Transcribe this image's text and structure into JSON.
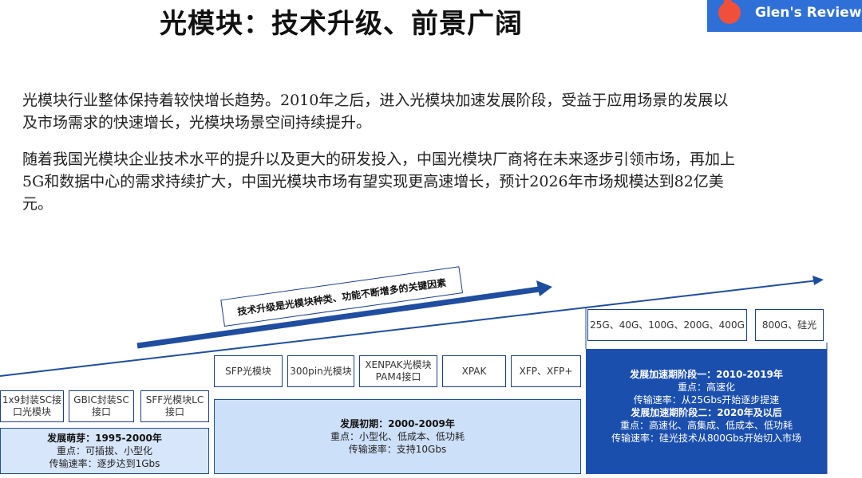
{
  "title": "光模块：技术升级、前景广阔",
  "logo": {
    "text": "Glen's Review"
  },
  "paragraphs": [
    "光模块行业整体保持着较快增长趋势。2010年之后，进入光模块加速发展阶段，受益于应用场景的发展以及市场需求的快速增长，光模块场景空间持续提升。",
    "随着我国光模块企业技术水平的提升以及更大的研发投入，中国光模块厂商将在未来逐步引领市场，再加上5G和数据中心的需求持续扩大，中国光模块市场有望实现更高速增长，预计2026年市场规模达到82亿美元。"
  ],
  "banner": "技术升级是光模块种类、功能不断增多的关键因素",
  "stage1": {
    "products": [
      "1x9封装SC接口光模块",
      "GBIC封装SC接口",
      "SFF光模块LC接口"
    ],
    "heading": "发展萌芽：1995-2000年",
    "lines": [
      "重点：可插拔、小型化",
      "传输速率：逐步达到1Gbs"
    ]
  },
  "stage2": {
    "products": [
      "SFP光模块",
      "300pin光模块",
      "XENPAK光模块PAM4接口",
      "XPAK",
      "XFP、XFP+"
    ],
    "heading": "发展初期：2000-2009年",
    "lines": [
      "重点：小型化、低成本、低功耗",
      "传输速率：支持10Gbs"
    ]
  },
  "stage3": {
    "products": [
      "25G、40G、100G、200G、400G",
      "800G、硅光"
    ],
    "heading1": "发展加速期阶段一：2010-2019年",
    "lines1": [
      "重点：高速化",
      "传输速率：从25Gbs开始逐步提速"
    ],
    "heading2": "发展加速期阶段二：2020年及以后",
    "lines2": [
      "重点：高速化、高集成、低成本、低功耗",
      "传输速率：硅光技术从800Gbs开始切入市场"
    ]
  },
  "colors": {
    "primary": "#1b4fae",
    "light": "#cde0f9",
    "lighter": "#d7e6fa"
  }
}
